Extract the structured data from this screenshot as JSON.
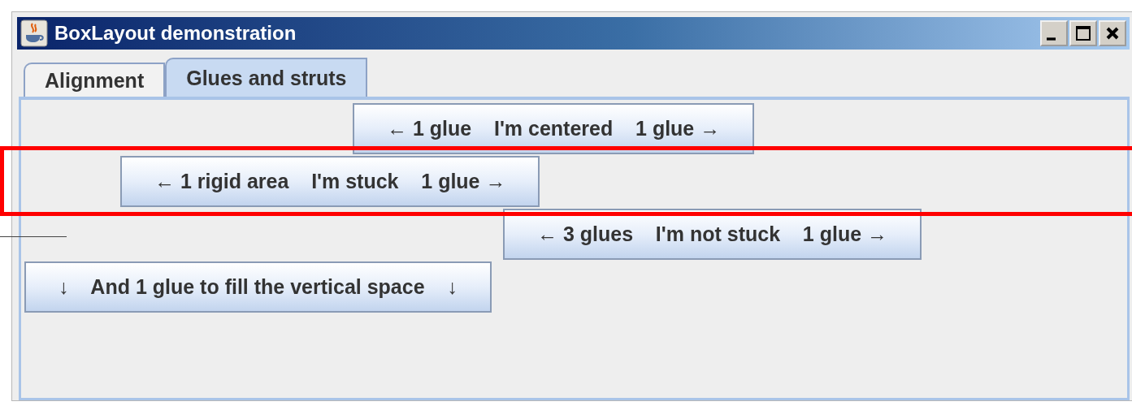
{
  "window": {
    "title": "BoxLayout demonstration"
  },
  "tabs": [
    {
      "label": "Alignment",
      "selected": false
    },
    {
      "label": "Glues and struts",
      "selected": true
    }
  ],
  "buttons": [
    {
      "label": "← 1 glue    I'm centered    1 glue →"
    },
    {
      "label": "← 1 rigid area    I'm stuck    1 glue →"
    },
    {
      "label": "← 3 glues    I'm not stuck    1 glue →"
    },
    {
      "label": "↓    And 1 glue to fill the vertical space    ↓"
    }
  ]
}
